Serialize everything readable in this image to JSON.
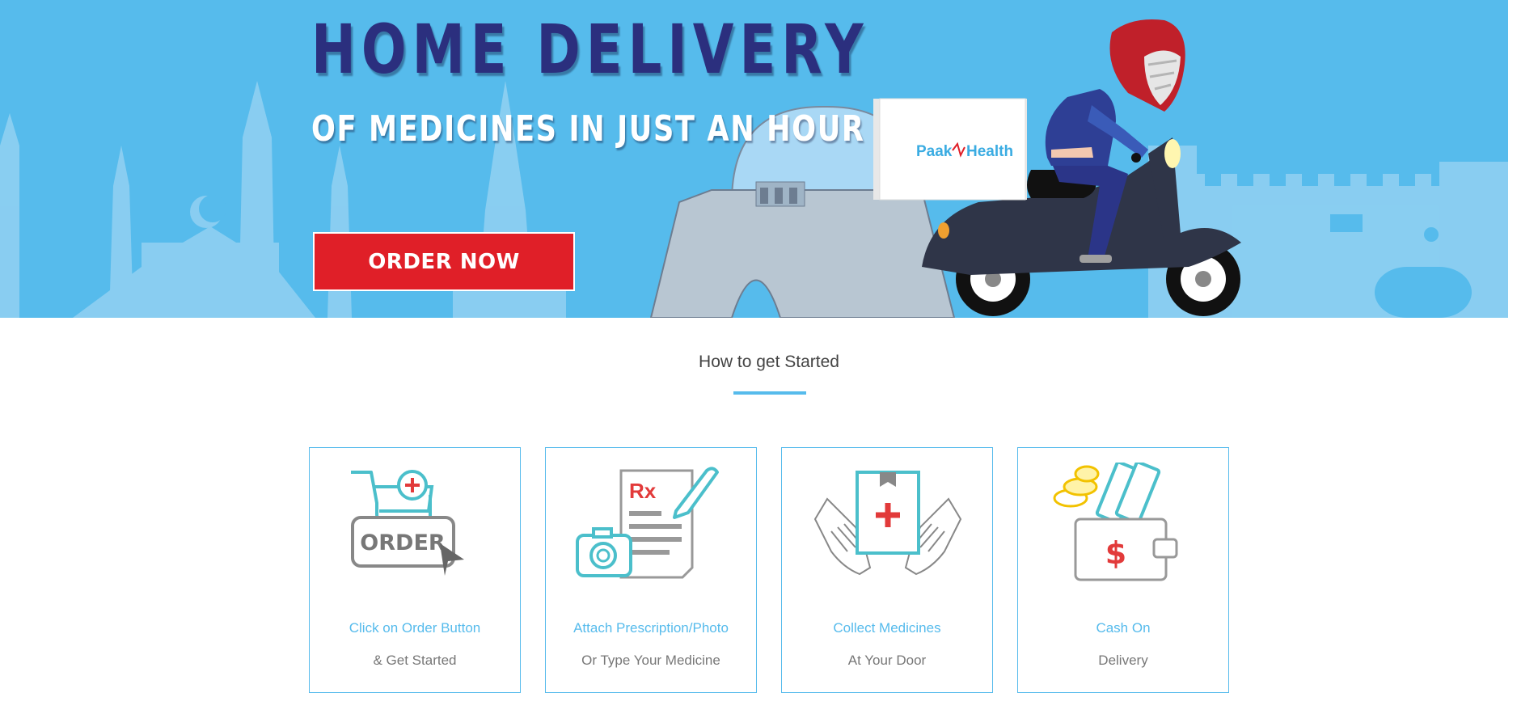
{
  "hero": {
    "title": "HOME DELIVERY",
    "subtitle": "OF MEDICINES IN JUST AN HOUR",
    "order_button_label": "ORDER NOW",
    "box_brand_left": "Paak",
    "box_brand_right": "Health"
  },
  "how_to": {
    "heading": "How to get Started",
    "steps": [
      {
        "icon": "order-cart-icon",
        "title": "Click on Order Button",
        "subtitle": "& Get Started"
      },
      {
        "icon": "prescription-camera-icon",
        "title": "Attach Prescription/Photo",
        "subtitle": "Or Type Your Medicine"
      },
      {
        "icon": "hands-medicine-icon",
        "title": "Collect Medicines",
        "subtitle": "At Your Door"
      },
      {
        "icon": "wallet-cash-icon",
        "title": "Cash On",
        "subtitle": "Delivery"
      }
    ],
    "order_icon_text": "ORDER",
    "rx_text": "Rx",
    "dollar_text": "$"
  },
  "colors": {
    "hero_bg": "#56bbec",
    "title_navy": "#2b2f7e",
    "order_red": "#e01f28",
    "accent_blue": "#56bbec"
  }
}
